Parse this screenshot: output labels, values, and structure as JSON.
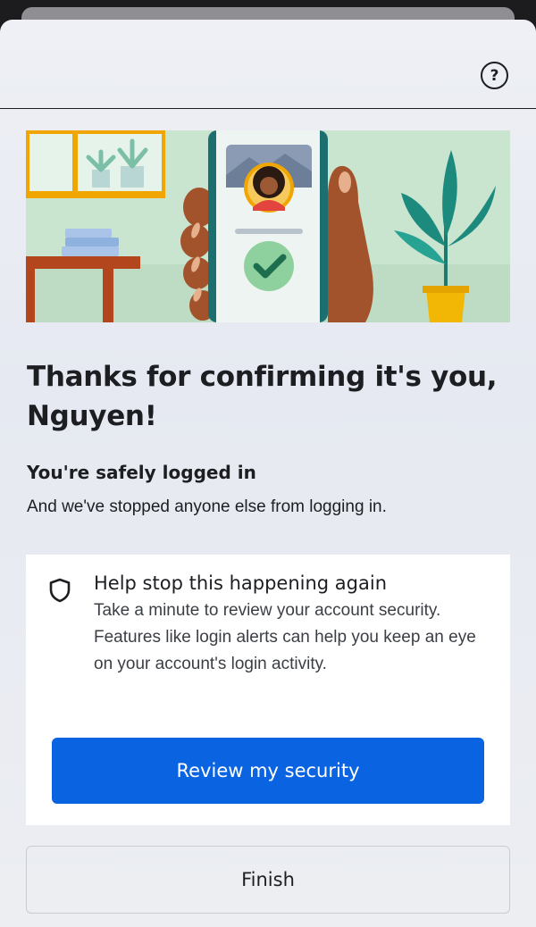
{
  "header": {
    "help_icon": "question-circle-icon",
    "help_glyph": "?"
  },
  "hero": {
    "illustration": "hand-holding-phone-with-profile-and-checkmark",
    "colors": {
      "background": "#c9e4cf",
      "window_frame": "#f0a500",
      "phone": "#1d6e6e",
      "checkmark_circle": "#8fd19e",
      "plant_pot": "#f2b705"
    }
  },
  "main": {
    "title": "Thanks for confirming it's you, Nguyen!",
    "subtitle": "You're safely logged in",
    "description": "And we've stopped anyone else from logging in."
  },
  "security_card": {
    "icon": "shield-icon",
    "title": "Help stop this happening again",
    "text": "Take a minute to review your account security. Features like login alerts can help you keep an eye on your account's login activity.",
    "button_label": "Review my security"
  },
  "footer": {
    "finish_label": "Finish"
  },
  "colors": {
    "primary": "#0a64e2",
    "text": "#1c1e21",
    "border": "#c9ccd1"
  }
}
